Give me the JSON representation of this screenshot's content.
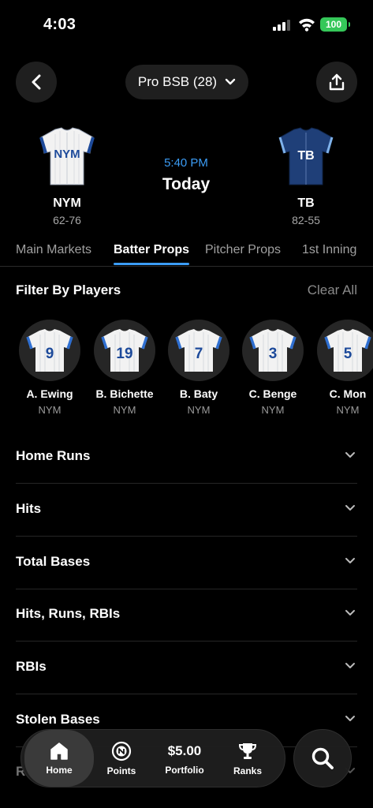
{
  "status_bar": {
    "time": "4:03",
    "battery": "100"
  },
  "header": {
    "league_label": "Pro BSB (28)"
  },
  "matchup": {
    "away": {
      "abbr": "NYM",
      "record": "62-76",
      "jersey_text": "NYM"
    },
    "home": {
      "abbr": "TB",
      "record": "82-55",
      "jersey_text": "TB"
    },
    "time": "5:40 PM",
    "day": "Today"
  },
  "tabs": [
    {
      "label": "Main Markets"
    },
    {
      "label": "Batter Props"
    },
    {
      "label": "Pitcher Props"
    },
    {
      "label": "1st Inning"
    }
  ],
  "filter": {
    "title": "Filter By Players",
    "clear_label": "Clear All"
  },
  "players": [
    {
      "name": "A. Ewing",
      "team": "NYM",
      "number": "9"
    },
    {
      "name": "B. Bichette",
      "team": "NYM",
      "number": "19"
    },
    {
      "name": "B. Baty",
      "team": "NYM",
      "number": "7"
    },
    {
      "name": "C. Benge",
      "team": "NYM",
      "number": "3"
    },
    {
      "name": "C. Mon",
      "team": "NYM",
      "number": "5"
    }
  ],
  "markets": [
    {
      "label": "Home Runs"
    },
    {
      "label": "Hits"
    },
    {
      "label": "Total Bases"
    },
    {
      "label": "Hits, Runs, RBIs"
    },
    {
      "label": "RBIs"
    },
    {
      "label": "Stolen Bases"
    },
    {
      "label": "R"
    }
  ],
  "bottom_nav": {
    "home": "Home",
    "points": "Points",
    "portfolio_value": "$5.00",
    "portfolio": "Portfolio",
    "ranks": "Ranks"
  },
  "colors": {
    "accent": "#3b9cf5",
    "battery": "#35c759",
    "tb_navy": "#1f3f78",
    "nym_blue": "#1d4a9a"
  }
}
